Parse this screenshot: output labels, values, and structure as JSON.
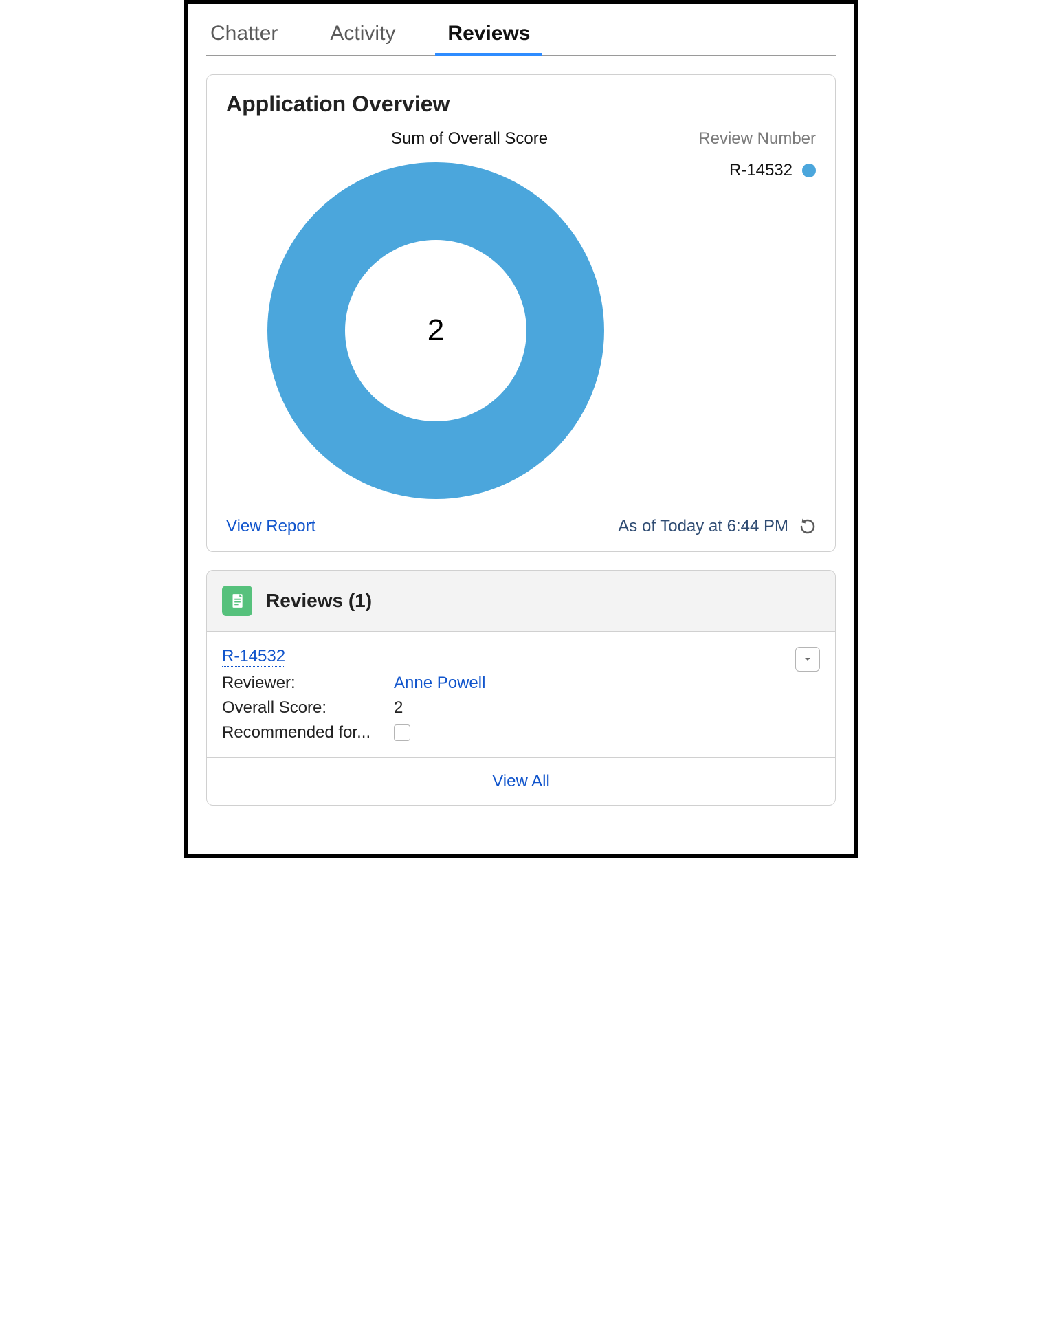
{
  "tabs": {
    "chatter": "Chatter",
    "activity": "Activity",
    "reviews": "Reviews"
  },
  "overview": {
    "title": "Application Overview",
    "chart_caption": "Sum of Overall Score",
    "legend_title": "Review Number",
    "legend_item": "R-14532",
    "view_report": "View Report",
    "timestamp": "As of Today at 6:44 PM"
  },
  "related": {
    "title": "Reviews (1)",
    "record_link": "R-14532",
    "fields": {
      "reviewer_label": "Reviewer:",
      "reviewer_value": "Anne Powell",
      "score_label": "Overall Score:",
      "score_value": "2",
      "recommended_label": "Recommended for..."
    },
    "view_all": "View All"
  },
  "chart_data": {
    "type": "pie",
    "title": "Sum of Overall Score",
    "categories": [
      "R-14532"
    ],
    "values": [
      2
    ],
    "total": 2,
    "legend_title": "Review Number"
  }
}
